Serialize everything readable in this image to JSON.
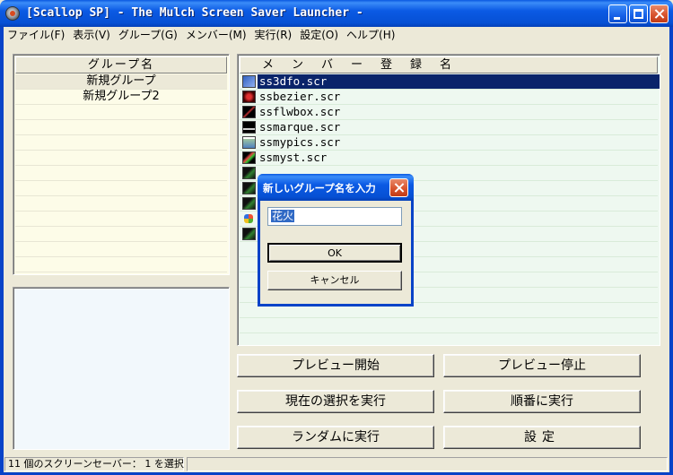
{
  "window": {
    "title": "[Scallop SP] - The Mulch Screen Saver Launcher -"
  },
  "menu": [
    "ファイル(F)",
    "表示(V)",
    "グループ(G)",
    "メンバー(M)",
    "実行(R)",
    "設定(O)",
    "ヘルプ(H)"
  ],
  "groups": {
    "header": "グループ名",
    "items": [
      {
        "label": "新規グループ",
        "selected": true
      },
      {
        "label": "新規グループ2",
        "selected": false
      }
    ]
  },
  "members": {
    "header": "メンバー登録名",
    "items": [
      {
        "name": "ss3dfo.scr",
        "selected": true,
        "icon": "3d-flying-objects-icon"
      },
      {
        "name": "ssbezier.scr",
        "selected": false,
        "icon": "bezier-icon"
      },
      {
        "name": "ssflwbox.scr",
        "selected": false,
        "icon": "flowerbox-icon"
      },
      {
        "name": "ssmarque.scr",
        "selected": false,
        "icon": "marquee-icon"
      },
      {
        "name": "ssmypics.scr",
        "selected": false,
        "icon": "my-pictures-icon"
      },
      {
        "name": "ssmyst.scr",
        "selected": false,
        "icon": "mystify-icon"
      },
      {
        "name": "",
        "selected": false,
        "icon": "screensaver-icon"
      },
      {
        "name": "",
        "selected": false,
        "icon": "screensaver-icon"
      },
      {
        "name": "",
        "selected": false,
        "icon": "screensaver-icon"
      },
      {
        "name": "",
        "selected": false,
        "icon": "windows-logo-icon"
      },
      {
        "name": "",
        "selected": false,
        "icon": "screensaver-icon"
      }
    ]
  },
  "buttons": {
    "preview_start": "プレビュー開始",
    "preview_stop": "プレビュー停止",
    "run_selected": "現在の選択を実行",
    "run_sequential": "順番に実行",
    "run_random": "ランダムに実行",
    "settings": "設定"
  },
  "statusbar": {
    "text": "11 個のスクリーンセーバー： 1 を選択"
  },
  "dialog": {
    "title": "新しいグループ名を入力",
    "input_value": "花火",
    "ok_label": "OK",
    "cancel_label": "キャンセル"
  },
  "colors": {
    "titlebar_blue": "#0650d4",
    "selection": "#0a246a",
    "group_list_bg": "#fdfce8",
    "member_list_bg": "#eef8f0",
    "close_red": "#d8542e"
  }
}
